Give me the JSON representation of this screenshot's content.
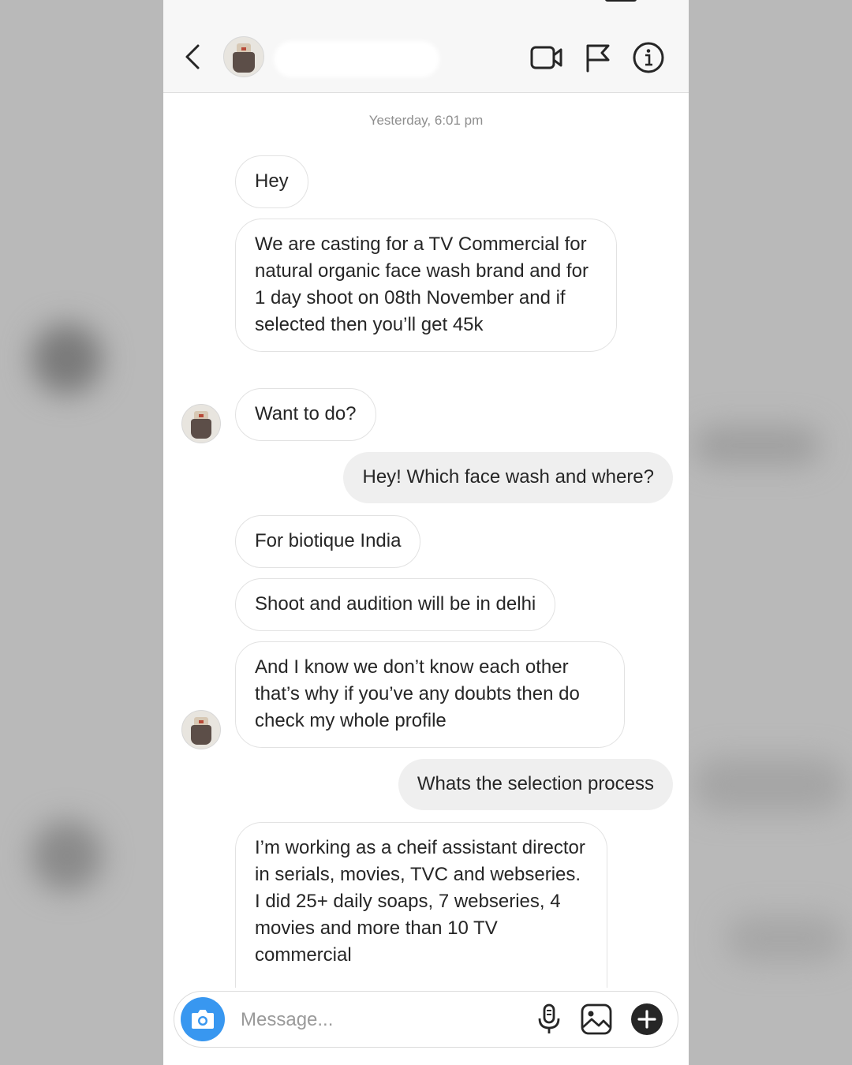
{
  "header": {
    "back_icon": "chevron-left-icon",
    "video_icon": "video-camera-icon",
    "flag_icon": "flag-icon",
    "info_icon": "info-icon"
  },
  "conversation": {
    "timestamp": "Yesterday, 6:01 pm",
    "messages": [
      {
        "dir": "in",
        "text": "Hey"
      },
      {
        "dir": "in",
        "text": "We are casting for a TV Commercial for natural organic face wash brand and for 1 day shoot on 08th November and if selected then you’ll get 45k"
      },
      {
        "dir": "in",
        "text": "Want to do?"
      },
      {
        "dir": "out",
        "text": "Hey! Which face wash and where?"
      },
      {
        "dir": "in",
        "text": "For biotique India"
      },
      {
        "dir": "in",
        "text": "Shoot and audition will be in delhi"
      },
      {
        "dir": "in",
        "text": "And I know we don’t know each other that’s why if you’ve any doubts then do check my whole profile"
      },
      {
        "dir": "out",
        "text": "Whats the selection process"
      },
      {
        "dir": "in",
        "text": "I’m working as a cheif assistant director in serials, movies, TVC and webseries. I did 25+ daily soaps, 7 webseries, 4 movies and more than 10 TV commercial"
      }
    ]
  },
  "composer": {
    "placeholder": "Message...",
    "camera_icon": "camera-icon",
    "mic_icon": "microphone-icon",
    "gallery_icon": "gallery-icon",
    "plus_icon": "plus-icon"
  },
  "colors": {
    "accent": "#3897f0",
    "outgoing_bubble": "#efefef",
    "text": "#262626"
  }
}
